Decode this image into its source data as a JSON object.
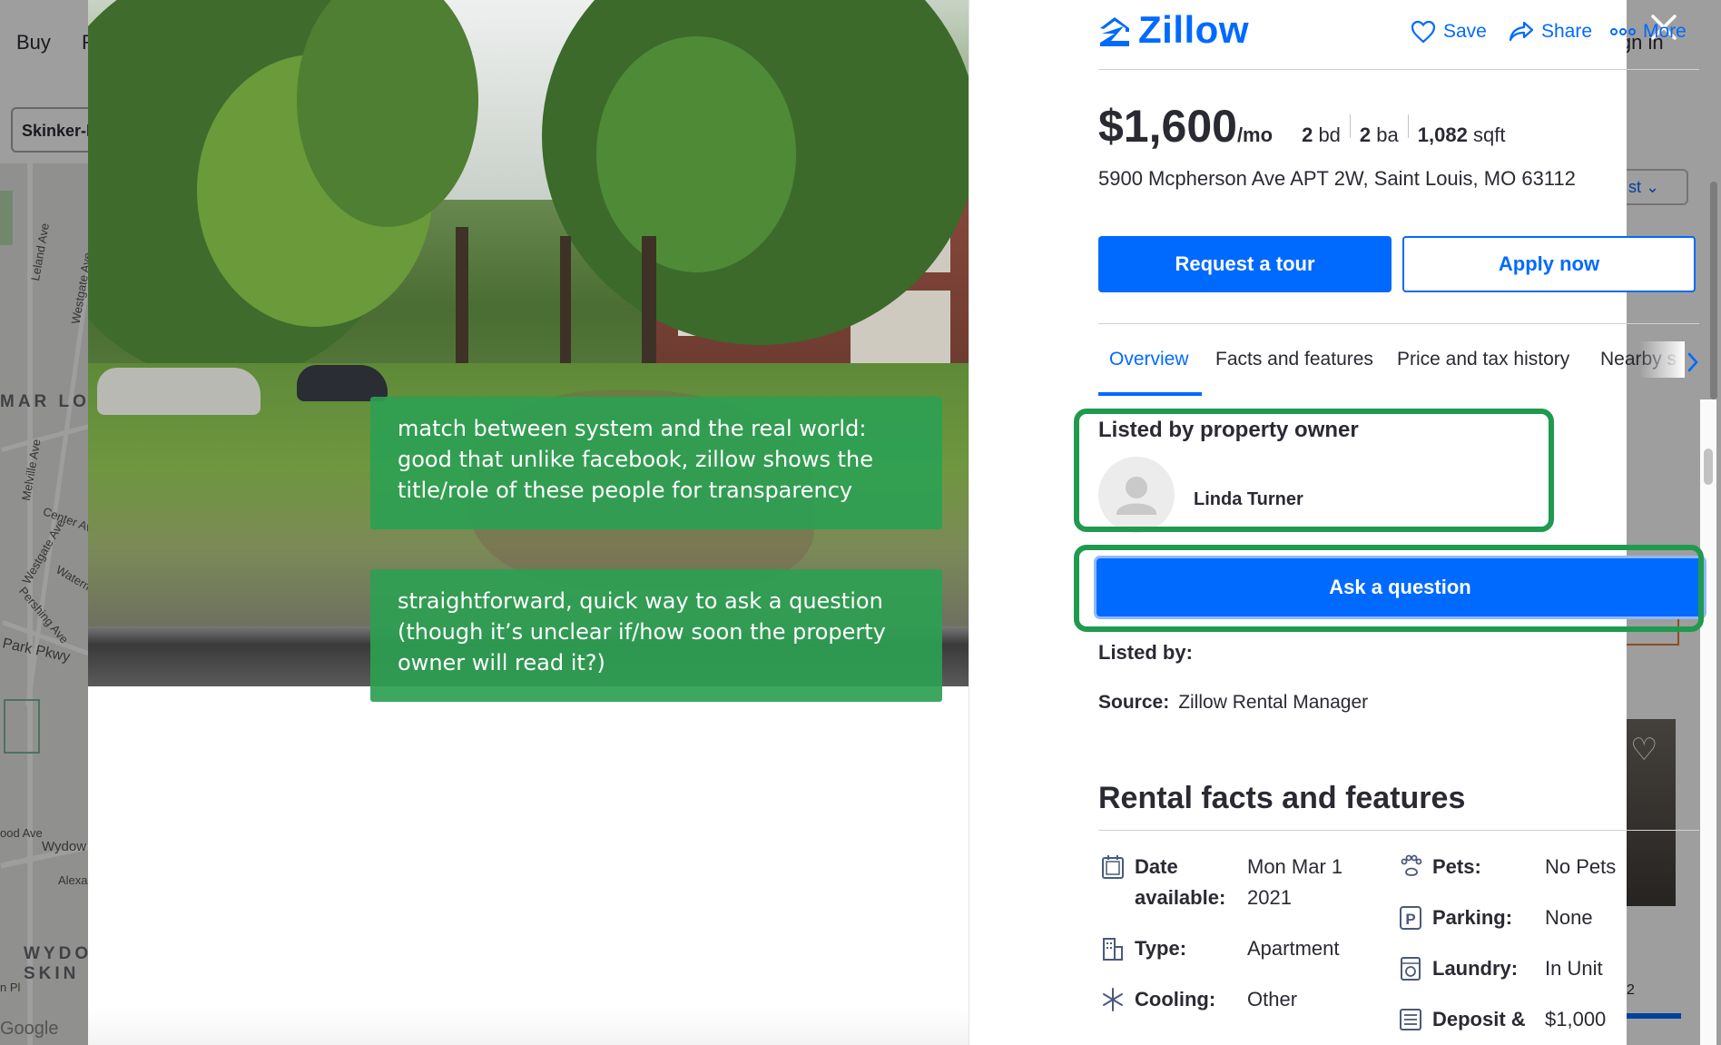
{
  "background": {
    "nav": {
      "buy": "Buy",
      "partial_tab": "R",
      "sign_in": "ign in"
    },
    "search_value": "Skinker-D",
    "sort_label": "st",
    "page_number": "2",
    "map_labels": [
      "Leland Ave",
      "Westgate Ave",
      "MAR LO",
      "Melville Ave",
      "Westgate Ave",
      "Center Ave",
      "Waterm",
      "Pershing Ave",
      "Park Pkwy",
      "ood Ave",
      "Wydow",
      "Alexa",
      "WYDO",
      "SKIN",
      "n Pl",
      "Google"
    ]
  },
  "header": {
    "logo_text": "Zillow",
    "save_label": "Save",
    "share_label": "Share",
    "more_label": "More"
  },
  "listing": {
    "price": "$1,600",
    "price_unit": "/mo",
    "beds_num": "2",
    "beds_unit": "bd",
    "baths_num": "2",
    "baths_unit": "ba",
    "sqft_num": "1,082",
    "sqft_unit": "sqft",
    "address": "5900 Mcpherson Ave APT 2W, Saint Louis, MO 63112"
  },
  "actions": {
    "request_tour": "Request a tour",
    "apply_now": "Apply now",
    "ask_question": "Ask a question"
  },
  "tabs": [
    {
      "label": "Overview",
      "active": true
    },
    {
      "label": "Facts and features"
    },
    {
      "label": "Price and tax history"
    },
    {
      "label": "Nearby s"
    }
  ],
  "owner": {
    "heading": "Listed by property owner",
    "name": "Linda Turner"
  },
  "listed_by_label": "Listed by:",
  "source": {
    "label": "Source:",
    "value": "Zillow Rental Manager"
  },
  "rental_facts": {
    "heading": "Rental facts and features",
    "left": [
      {
        "icon": "calendar-icon",
        "label": "Date available:",
        "value": "Mon Mar 1 2021"
      },
      {
        "icon": "building-icon",
        "label": "Type:",
        "value": "Apartment"
      },
      {
        "icon": "snowflake-icon",
        "label": "Cooling:",
        "value": "Other"
      }
    ],
    "right": [
      {
        "icon": "paw-icon",
        "label": "Pets:",
        "value": "No Pets"
      },
      {
        "icon": "parking-icon",
        "label": "Parking:",
        "value": "None"
      },
      {
        "icon": "washer-icon",
        "label": "Laundry:",
        "value": "In Unit"
      },
      {
        "icon": "list-icon",
        "label": "Deposit &",
        "value": "$1,000"
      }
    ]
  },
  "annotations": [
    "match between system and the real world: good that unlike facebook, zillow shows the title/role of these people for transparency",
    "straightforward, quick way to ask a question (though it’s unclear if/how soon the property owner will read it?)"
  ],
  "colors": {
    "brand_blue": "#006aff",
    "annotation_green": "#2ca052",
    "highlight_green": "#1f9a4f"
  }
}
